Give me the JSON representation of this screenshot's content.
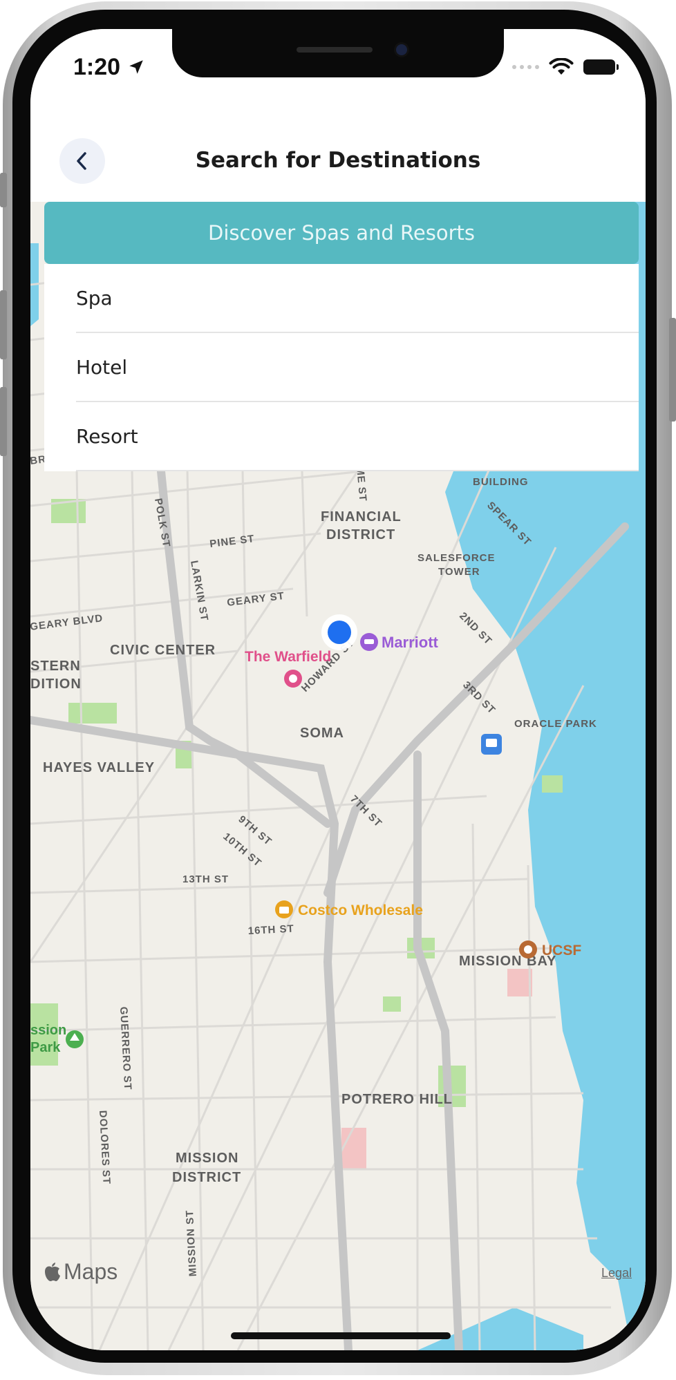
{
  "status_bar": {
    "time": "1:20"
  },
  "header": {
    "title": "Search for Destinations"
  },
  "discover_button": {
    "label": "Discover Spas and Resorts"
  },
  "options": [
    {
      "label": "Spa"
    },
    {
      "label": "Hotel"
    },
    {
      "label": "Resort"
    }
  ],
  "map": {
    "areas": [
      "FINANCIAL DISTRICT",
      "CIVIC CENTER",
      "SOMA",
      "HAYES VALLEY",
      "MISSION BAY",
      "POTRERO HILL",
      "MISSION DISTRICT",
      "WESTERN ADDITION"
    ],
    "landmarks": [
      "FERRY BUILDING",
      "SALESFORCE TOWER",
      "ORACLE PARK"
    ],
    "streets": [
      "BROADWAY ST",
      "PINE ST",
      "GEARY ST",
      "GEARY BLVD",
      "POLK ST",
      "LARKIN ST",
      "SOME ST",
      "SPEAR ST",
      "2ND ST",
      "HOWARD ST",
      "3RD ST",
      "9TH ST",
      "10TH ST",
      "7TH ST",
      "13TH ST",
      "16TH ST",
      "GUERRERO ST",
      "DOLORES ST",
      "MISSION ST"
    ],
    "pois": [
      {
        "name": "Marriott",
        "color": "#9a5cd6"
      },
      {
        "name": "The Warfield",
        "color": "#e0508a"
      },
      {
        "name": "Costco Wholesale",
        "color": "#e8a21d"
      },
      {
        "name": "UCSF",
        "color": "#b86a34"
      },
      {
        "name": "Mission Park",
        "color": "#4caf50"
      }
    ],
    "provider": "Maps",
    "legal": "Legal"
  },
  "colors": {
    "accent": "#56b9c1",
    "water": "#7fd0ea",
    "park": "#b9e2a1",
    "user_location": "#1e6ff0"
  }
}
